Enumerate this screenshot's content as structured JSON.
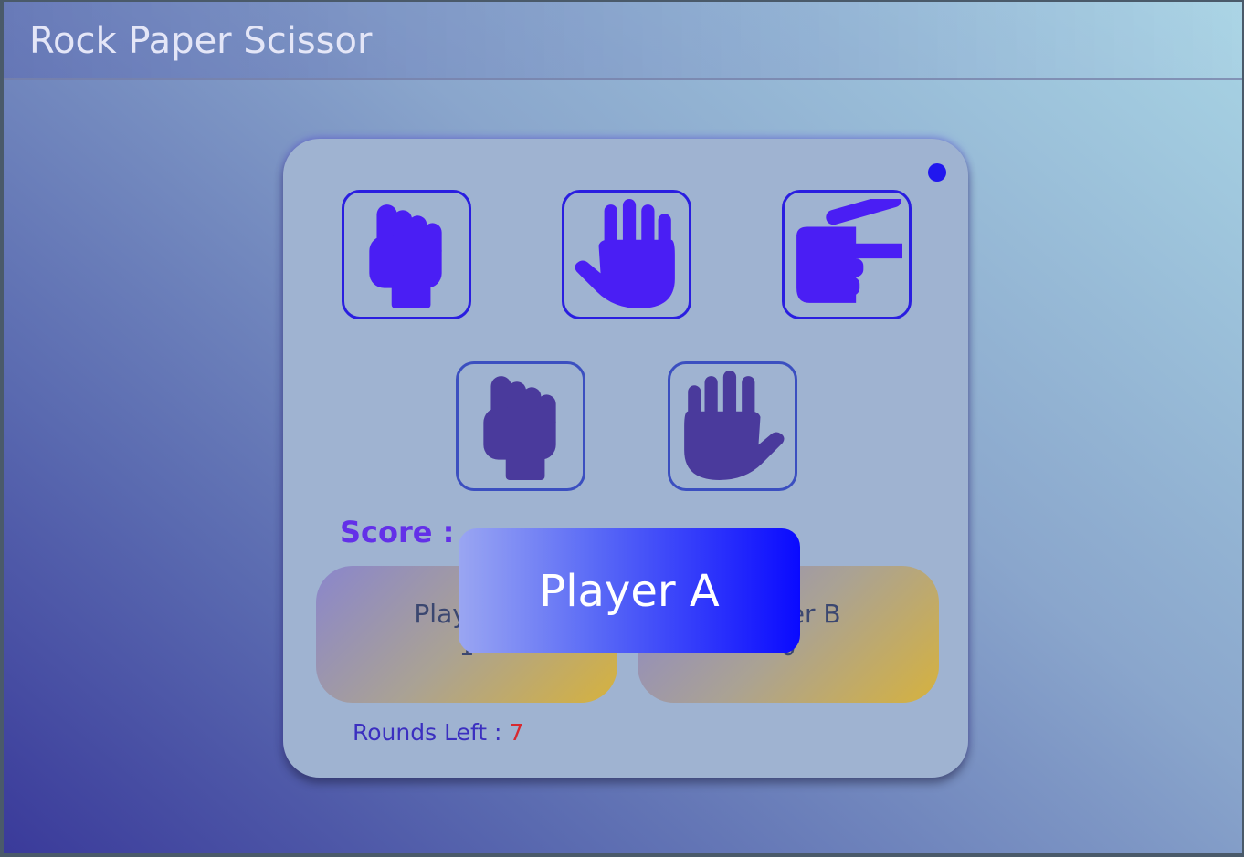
{
  "app": {
    "title": "Rock Paper Scissor"
  },
  "choices": [
    {
      "label": "rock",
      "icon": "rock-hand-icon",
      "color": "#4a1ef4"
    },
    {
      "label": "paper",
      "icon": "paper-hand-icon",
      "color": "#4a1ef4"
    },
    {
      "label": "scissor",
      "icon": "scissor-hand-icon",
      "color": "#4a1ef4"
    }
  ],
  "played": [
    {
      "label": "rock",
      "icon": "rock-hand-icon",
      "color": "#4a3a9c"
    },
    {
      "label": "paper",
      "icon": "paper-hand-icon",
      "color": "#4a3a9c"
    }
  ],
  "score": {
    "label": "Score :",
    "player_a": {
      "name": "Player A",
      "value": "1"
    },
    "player_b": {
      "name": "Player B",
      "value": "0"
    }
  },
  "rounds": {
    "label": "Rounds Left :",
    "value": "7"
  },
  "toast": {
    "text": "Player A"
  },
  "colors": {
    "accent": "#2117ee",
    "score_label": "#6330e8",
    "rounds_value": "#d82a30"
  }
}
